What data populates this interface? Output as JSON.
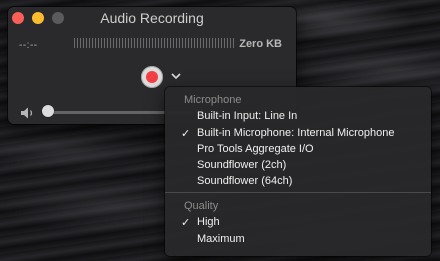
{
  "window": {
    "title": "Audio Recording",
    "time": "--:--",
    "file_size": "Zero KB",
    "volume_level": 0.05
  },
  "menu": {
    "microphone_header": "Microphone",
    "microphone_items": [
      {
        "label": "Built-in Input: Line In",
        "checked": false
      },
      {
        "label": "Built-in Microphone: Internal Microphone",
        "checked": true
      },
      {
        "label": "Pro Tools Aggregate I/O",
        "checked": false
      },
      {
        "label": "Soundflower (2ch)",
        "checked": false
      },
      {
        "label": "Soundflower (64ch)",
        "checked": false
      }
    ],
    "quality_header": "Quality",
    "quality_items": [
      {
        "label": "High",
        "checked": true
      },
      {
        "label": "Maximum",
        "checked": false
      }
    ],
    "check_mark": "✓"
  },
  "colors": {
    "record_red": "#f23f43",
    "close_red": "#fc5f57",
    "minimize_yellow": "#fdbc2e"
  }
}
